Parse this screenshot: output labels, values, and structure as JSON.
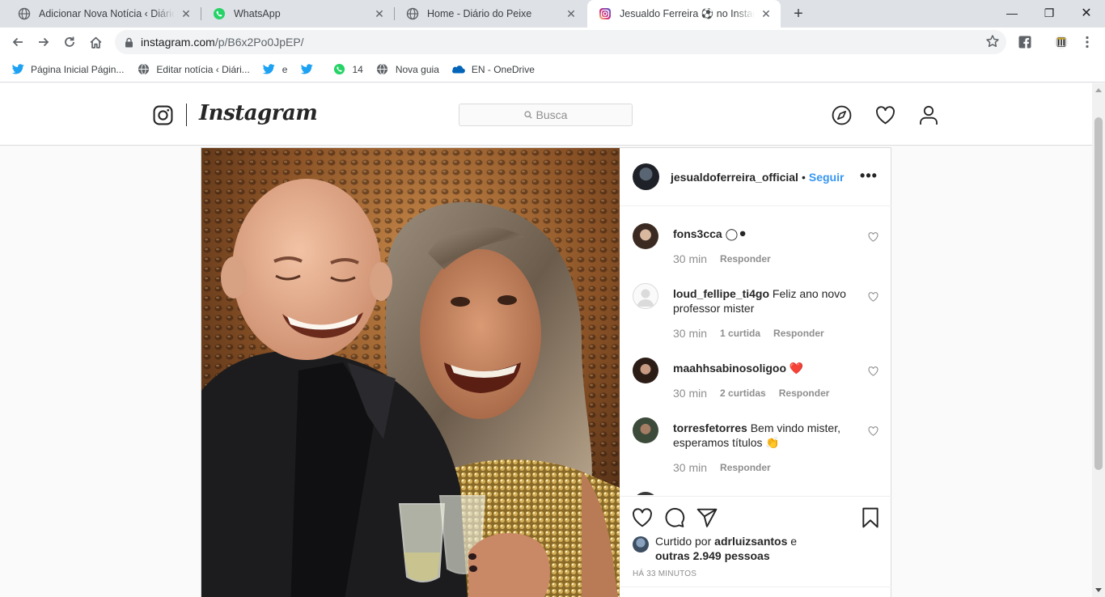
{
  "browser": {
    "tabs": [
      {
        "title": "Adicionar Nova Notícia ‹ Diário do Peixe",
        "favicon": "globe-icon"
      },
      {
        "title": "WhatsApp",
        "favicon": "whatsapp-icon"
      },
      {
        "title": "Home - Diário do Peixe",
        "favicon": "globe-icon"
      },
      {
        "title": "Jesualdo Ferreira ⚽ no Instagram",
        "favicon": "instagram-icon",
        "active": true
      }
    ],
    "new_tab_label": "+",
    "window_controls": {
      "minimize": "—",
      "maximize": "❐",
      "close": "✕"
    },
    "url": {
      "host": "instagram.com",
      "path": "/p/B6x2Po0JpEP/"
    },
    "bookmarks": [
      {
        "label": "Página Inicial Págin...",
        "icon": "twitter-icon"
      },
      {
        "label": "Editar notícia ‹ Diári...",
        "icon": "globe-icon"
      },
      {
        "label": "e",
        "icon": "twitter-icon"
      },
      {
        "label": "",
        "icon": "twitter-icon"
      },
      {
        "label": "14",
        "icon": "whatsapp-icon"
      },
      {
        "label": "Nova guia",
        "icon": "globe-icon"
      },
      {
        "label": "EN - OneDrive",
        "icon": "onedrive-icon"
      }
    ]
  },
  "instagram": {
    "wordmark": "Instagram",
    "search_placeholder": "Busca",
    "post": {
      "username": "jesualdoferreira_official",
      "separator": "•",
      "follow_label": "Seguir",
      "more_label": "•••",
      "comments": [
        {
          "user": "fons3cca",
          "text": "◯⚫",
          "time": "30 min",
          "likes": "",
          "reply": "Responder"
        },
        {
          "user": "loud_fellipe_ti4go",
          "text": "Feliz ano novo professor mister",
          "time": "30 min",
          "likes": "1 curtida",
          "reply": "Responder"
        },
        {
          "user": "maahhsabinosoligoo",
          "text": "❤️",
          "time": "30 min",
          "likes": "2 curtidas",
          "reply": "Responder"
        },
        {
          "user": "torresfetorres",
          "text": "Bem vindo mister, esperamos títulos 👏",
          "time": "30 min",
          "likes": "",
          "reply": "Responder"
        }
      ],
      "liked_prefix": "Curtido por",
      "liked_user": "adrluizsantos",
      "liked_mid": "e",
      "liked_others": "outras 2.949 pessoas",
      "posted_ago": "HÁ 33 MINUTOS"
    }
  },
  "colors": {
    "link_blue": "#3897f0",
    "tabstrip": "#dee1e6",
    "border": "#dbdbdb"
  }
}
